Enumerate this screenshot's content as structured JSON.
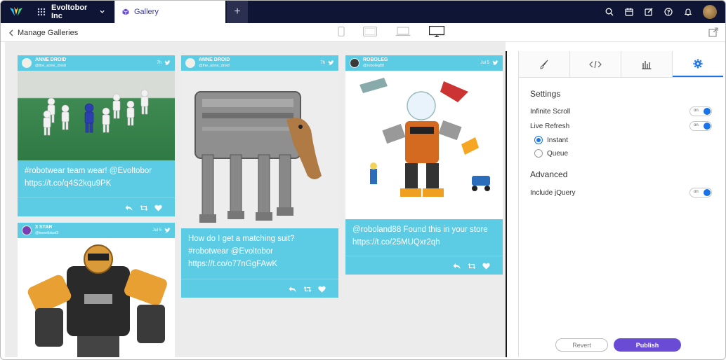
{
  "topbar": {
    "org_name": "Evoltobor Inc",
    "active_tab": "Gallery",
    "plus": "+"
  },
  "subbar": {
    "back_label": "Manage Galleries"
  },
  "cards": [
    {
      "name": "ANNE DROID",
      "handle": "@the_anne_droid",
      "time": "7h",
      "text": "#robotwear team wear! @Evoltobor https://t.co/q4S2kqu9PK"
    },
    {
      "name": "ANNE DROID",
      "handle": "@the_anne_droid",
      "time": "7h",
      "text": "How do I get a matching suit? #robotwear @Evoltobor https://t.co/o77nGgFAwK"
    },
    {
      "name": "ROBOLEG",
      "handle": "@roboleg88",
      "time": "Jul 5",
      "text": "@roboland88 Found this in your store https://t.co/25MUQxr2qh"
    },
    {
      "name": "3 STAR",
      "handle": "@tweetblast3",
      "time": "Jul 5",
      "text": ""
    }
  ],
  "panel": {
    "settings_title": "Settings",
    "infinite_scroll": "Infinite Scroll",
    "live_refresh": "Live Refresh",
    "toggle_on": "on",
    "instant": "Instant",
    "queue": "Queue",
    "advanced_title": "Advanced",
    "include_jquery": "Include jQuery",
    "revert": "Revert",
    "publish": "Publish"
  },
  "colors": {
    "topbar": "#0f1535",
    "card": "#5ccbe4",
    "accent": "#1a73e8",
    "publish": "#6a4bd6"
  }
}
